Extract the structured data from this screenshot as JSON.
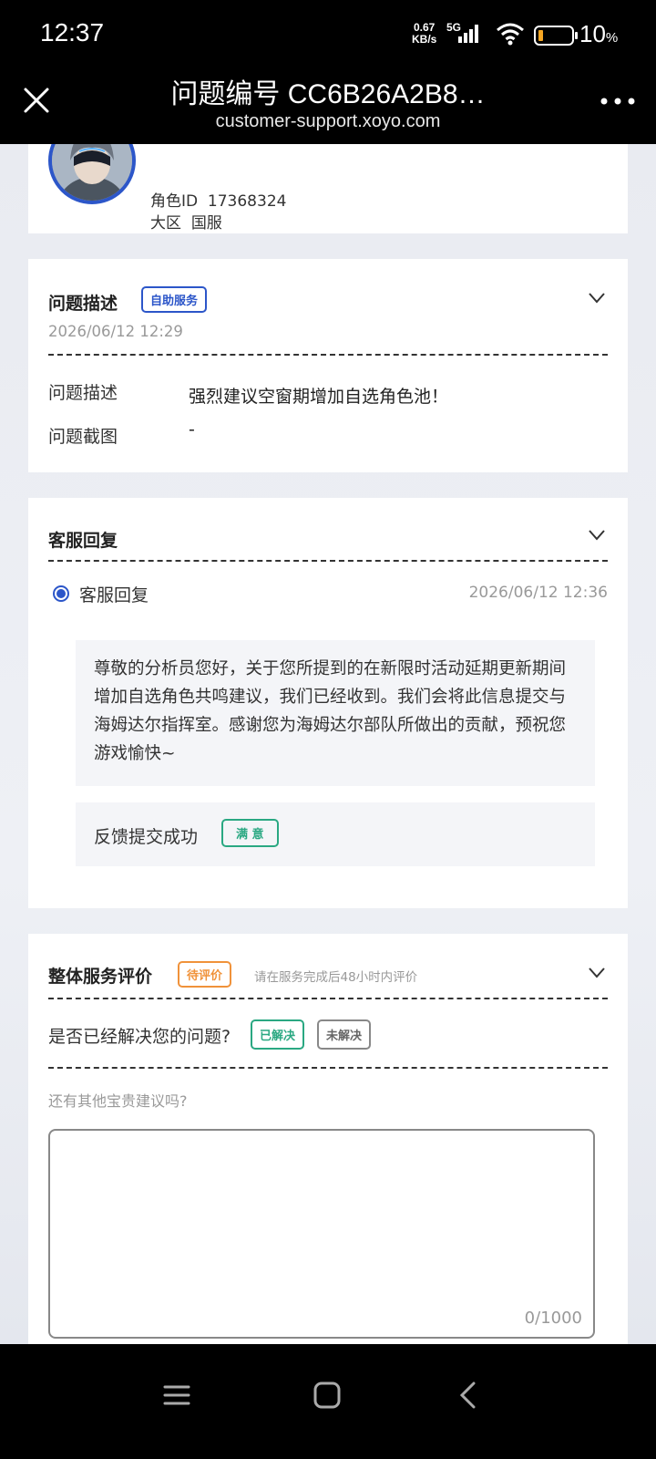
{
  "status_bar": {
    "time": "12:37",
    "net_speed_value": "0.67",
    "net_speed_unit": "KB/s",
    "network": "5G",
    "battery": "10",
    "battery_unit": "%",
    "battery_color": "#f5a623"
  },
  "title_bar": {
    "title": "问题编号 CC6B26A2B8…",
    "url": "customer-support.xoyo.com",
    "close_icon": "close-icon",
    "more_icon": "more-icon"
  },
  "profile": {
    "role_id_label": "角色ID",
    "role_id": "17368324",
    "region_label": "大区",
    "region": "国服"
  },
  "problem": {
    "title": "问题描述",
    "tag": "自助服务",
    "date": "2026/06/12 12:29",
    "desc_label": "问题描述",
    "desc_value": "强烈建议空窗期增加自选角色池！",
    "screenshot_label": "问题截图",
    "screenshot_value": "-"
  },
  "reply": {
    "title": "客服回复",
    "item_label": "客服回复",
    "item_date": "2026/06/12 12:36",
    "text": "尊敬的分析员您好，关于您所提到的在新限时活动延期更新期间增加自选角色共鸣建议，我们已经收到。我们会将此信息提交与海姆达尔指挥室。感谢您为海姆达尔部队所做出的贡献，预祝您游戏愉快~",
    "feedback_label": "反馈提交成功",
    "feedback_tag": "满 意"
  },
  "rating": {
    "title": "整体服务评价",
    "status_tag": "待评价",
    "hint": "请在服务完成后48小时内评价",
    "question": "是否已经解决您的问题?",
    "resolved": "已解决",
    "unresolved": "未解决",
    "suggest_label": "还有其他宝贵建议吗?",
    "counter": "0/1000"
  },
  "colors": {
    "accent_blue": "#2c56c9",
    "accent_orange": "#f0923a",
    "accent_green": "#2aa882"
  }
}
